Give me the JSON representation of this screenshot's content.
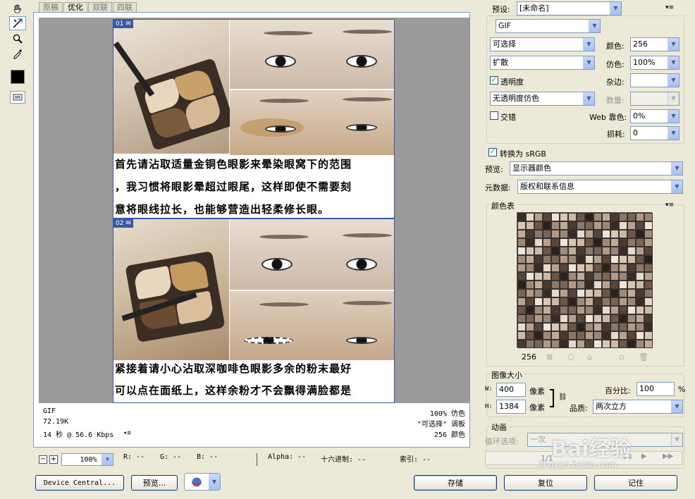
{
  "tabs": [
    "原稿",
    "优化",
    "双联",
    "四联"
  ],
  "tools": [
    "hand-tool-icon",
    "slice-select-tool-icon",
    "zoom-tool-icon",
    "eyedropper-icon"
  ],
  "slice1": {
    "tag": "01",
    "lines": [
      "首先请沾取适量金铜色眼影来晕染眼窝下的范围",
      "，我习惯将眼影晕超过眼尾，这样即使不需要刻",
      "意将眼线拉长，也能够营造出轻柔修长眼。"
    ]
  },
  "slice2": {
    "tag": "02",
    "lines": [
      "紧接着请小心沾取深咖啡色眼影多余的粉末最好",
      "可以点在面纸上，这样余粉才不会飘得满脸都是"
    ]
  },
  "status": {
    "format": "GIF",
    "size": "72.19K",
    "time": "14 秒 @ 56.6 Kbps",
    "dither": "100% 仿色",
    "palette": "\"可选择\" 调板",
    "colors": "256 颜色"
  },
  "bottom": {
    "zoom": "100%",
    "r": "R: --",
    "g": "G: --",
    "b": "B: --",
    "alpha": "Alpha: --",
    "hex": "十六进制: --",
    "index": "索引: --"
  },
  "buttons": {
    "device": "Device Central...",
    "preview": "预览...",
    "save": "存储",
    "reset": "复位",
    "remember": "记住"
  },
  "panel": {
    "preset_label": "预设:",
    "preset_value": "[未命名]",
    "format": "GIF",
    "reduction": "可选择",
    "colors_label": "颜色:",
    "colors_value": "256",
    "dither_algo": "扩散",
    "dither_label": "仿色:",
    "dither_value": "100%",
    "transparency_label": "透明度",
    "matte_label": "杂边:",
    "trans_dither": "无透明度仿色",
    "amount_label": "数量:",
    "interlaced_label": "交错",
    "web_snap_label": "Web 靠色:",
    "web_snap_value": "0%",
    "lossy_label": "损耗:",
    "lossy_value": "0",
    "srgb_label": "转换为 sRGB",
    "preview_label": "预览:",
    "preview_value": "显示器颜色",
    "metadata_label": "元数据:",
    "metadata_value": "版权和联系信息",
    "color_table_label": "颜色表",
    "color_count": "256",
    "image_size_label": "图像大小",
    "w_label": "W:",
    "w_value": "400",
    "w_unit": "像素",
    "h_label": "H:",
    "h_value": "1384",
    "h_unit": "像素",
    "percent_label": "百分比:",
    "percent_value": "100",
    "percent_unit": "%",
    "quality_label": "品质:",
    "quality_value": "两次立方",
    "animation_label": "动画",
    "loop_label": "循环选项:",
    "loop_value": "一次",
    "frame_counter": "1/1"
  },
  "watermark": "Bai经验",
  "watermark_url": "jingyan.baidu.com",
  "palette": [
    "#3a2a22",
    "#6e5546",
    "#b49a85",
    "#d9c7b6",
    "#8c7666",
    "#5a4538",
    "#c2ab96",
    "#e6d9cc",
    "#2b201b",
    "#9e8676",
    "#d0b8a2",
    "#7a6555",
    "#efe4d8",
    "#4a3a30",
    "#b8a08c",
    "#a38a78"
  ]
}
